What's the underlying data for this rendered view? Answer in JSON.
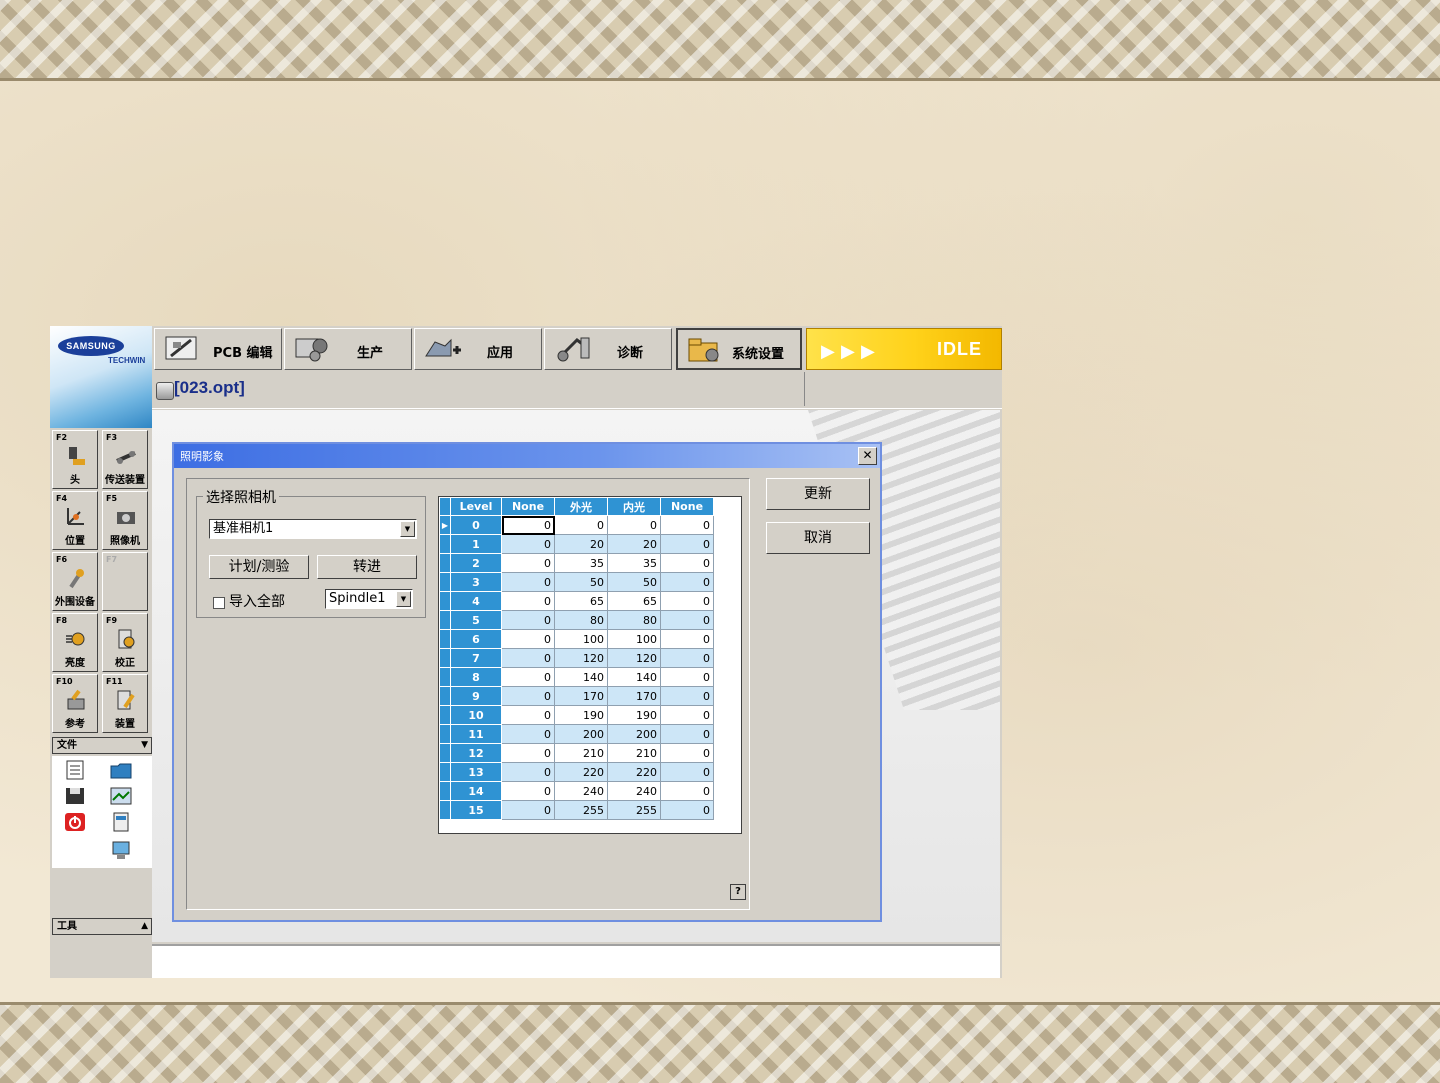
{
  "app": {
    "logo_text": "SAMSUNG",
    "logo_sub": "TECHWIN",
    "status": "IDLE",
    "title": "[023.opt]"
  },
  "tabs": [
    {
      "label": "PCB 编辑",
      "icon": "pcb-edit-icon"
    },
    {
      "label": "生产",
      "icon": "production-icon"
    },
    {
      "label": "应用",
      "icon": "application-icon"
    },
    {
      "label": "诊断",
      "icon": "diagnosis-icon"
    },
    {
      "label": "系统设置",
      "icon": "system-settings-icon",
      "active": true
    }
  ],
  "fkeys": [
    {
      "key": "F2",
      "label": "头"
    },
    {
      "key": "F3",
      "label": "传送装置"
    },
    {
      "key": "F4",
      "label": "位置"
    },
    {
      "key": "F5",
      "label": "照像机"
    },
    {
      "key": "F6",
      "label": "外围设备"
    },
    {
      "key": "F7",
      "label": ""
    },
    {
      "key": "F8",
      "label": "亮度"
    },
    {
      "key": "F9",
      "label": "校正"
    },
    {
      "key": "F10",
      "label": "参考"
    },
    {
      "key": "F11",
      "label": "装置"
    }
  ],
  "sections": {
    "file": "文件",
    "tools": "工具"
  },
  "dialog": {
    "title": "照明影象",
    "group_label": "选择照相机",
    "camera_value": "基准相机1",
    "plan_button": "计划/测验",
    "move_button": "转进",
    "import_all_label": "导入全部",
    "spindle_value": "Spindle1",
    "update_button": "更新",
    "cancel_button": "取消",
    "help": "?"
  },
  "grid": {
    "headers": [
      "Level",
      "None",
      "外光",
      "内光",
      "None"
    ],
    "rows": [
      [
        "0",
        "0",
        "0",
        "0",
        "0"
      ],
      [
        "1",
        "0",
        "20",
        "20",
        "0"
      ],
      [
        "2",
        "0",
        "35",
        "35",
        "0"
      ],
      [
        "3",
        "0",
        "50",
        "50",
        "0"
      ],
      [
        "4",
        "0",
        "65",
        "65",
        "0"
      ],
      [
        "5",
        "0",
        "80",
        "80",
        "0"
      ],
      [
        "6",
        "0",
        "100",
        "100",
        "0"
      ],
      [
        "7",
        "0",
        "120",
        "120",
        "0"
      ],
      [
        "8",
        "0",
        "140",
        "140",
        "0"
      ],
      [
        "9",
        "0",
        "170",
        "170",
        "0"
      ],
      [
        "10",
        "0",
        "190",
        "190",
        "0"
      ],
      [
        "11",
        "0",
        "200",
        "200",
        "0"
      ],
      [
        "12",
        "0",
        "210",
        "210",
        "0"
      ],
      [
        "13",
        "0",
        "220",
        "220",
        "0"
      ],
      [
        "14",
        "0",
        "240",
        "240",
        "0"
      ],
      [
        "15",
        "0",
        "255",
        "255",
        "0"
      ]
    ]
  },
  "colors": {
    "accent": "#2f93d3",
    "title_blue": "#3d6ee3",
    "idle_yellow": "#ffd21a"
  }
}
